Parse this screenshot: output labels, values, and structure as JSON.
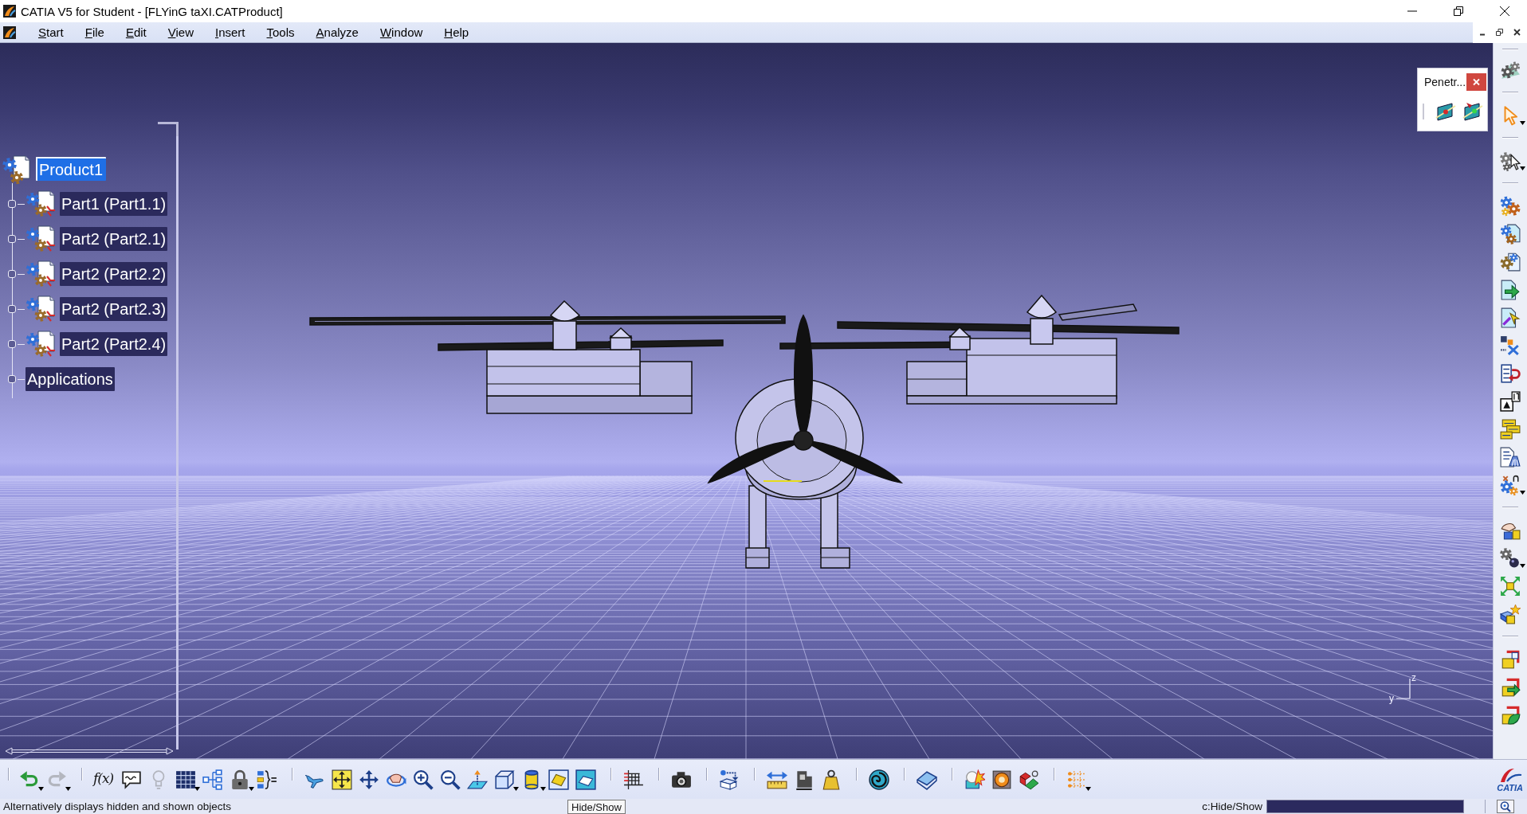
{
  "window": {
    "title": "CATIA V5 for Student - [FLYinG taXI.CATProduct]"
  },
  "menu_bar": {
    "items": [
      "Start",
      "File",
      "Edit",
      "View",
      "Insert",
      "Tools",
      "Analyze",
      "Window",
      "Help"
    ]
  },
  "tree": {
    "items": [
      {
        "kind": "product",
        "label": "Product1",
        "selected": true,
        "children": [
          {
            "kind": "part",
            "label": "Part1 (Part1.1)",
            "selected": false
          },
          {
            "kind": "part",
            "label": "Part2 (Part2.1)",
            "selected": false
          },
          {
            "kind": "part",
            "label": "Part2 (Part2.2)",
            "selected": false
          },
          {
            "kind": "part",
            "label": "Part2 (Part2.3)",
            "selected": false
          },
          {
            "kind": "part",
            "label": "Part2 (Part2.4)",
            "selected": false
          },
          {
            "kind": "branch",
            "label": "Applications",
            "selected": false
          }
        ]
      }
    ]
  },
  "penetration_panel": {
    "title": "Penetr..."
  },
  "compass": {
    "z_label": "z",
    "y_label": "y"
  },
  "right_toolbar": {
    "groups": [
      [
        {
          "kind": "gears",
          "dropdown": false
        }
      ],
      [
        {
          "kind": "pointer",
          "dropdown": true
        }
      ],
      [
        {
          "kind": "gear-pointer",
          "dropdown": true
        }
      ],
      [
        {
          "kind": "gear-cluster",
          "dropdown": false
        },
        {
          "kind": "gear-document",
          "dropdown": false
        },
        {
          "kind": "gear-sheet",
          "dropdown": false
        },
        {
          "kind": "document-arrow",
          "dropdown": false
        },
        {
          "kind": "document-pointer",
          "dropdown": false
        },
        {
          "kind": "blocks-cross",
          "dropdown": false
        },
        {
          "kind": "list-arrow",
          "dropdown": false
        },
        {
          "kind": "triangle-box",
          "dropdown": false
        },
        {
          "kind": "stacked-boxes",
          "dropdown": false
        },
        {
          "kind": "document-fan",
          "dropdown": false
        },
        {
          "kind": "gear-cross",
          "dropdown": true
        }
      ],
      [
        {
          "kind": "hand-blocks",
          "dropdown": false
        },
        {
          "kind": "gear-ball",
          "dropdown": true
        },
        {
          "kind": "explode-arrows",
          "dropdown": false
        },
        {
          "kind": "star-blocks",
          "dropdown": false
        }
      ],
      [
        {
          "kind": "block-corner",
          "dropdown": false
        },
        {
          "kind": "block-arrow",
          "dropdown": false
        },
        {
          "kind": "block-leaf",
          "dropdown": false
        }
      ]
    ]
  },
  "bottom_toolbar": {
    "groups": [
      [
        {
          "kind": "undo",
          "dropdown": true,
          "disabled": false
        },
        {
          "kind": "redo",
          "dropdown": true,
          "disabled": true
        }
      ],
      [
        {
          "kind": "formula",
          "glyph": "f(x)",
          "dropdown": false,
          "disabled": false
        },
        {
          "kind": "comment",
          "dropdown": false,
          "disabled": false
        },
        {
          "kind": "bulb",
          "dropdown": false,
          "disabled": true
        },
        {
          "kind": "table",
          "dropdown": true,
          "disabled": false
        },
        {
          "kind": "tree-graph",
          "dropdown": false,
          "disabled": false
        },
        {
          "kind": "lock",
          "dropdown": true,
          "disabled": false
        },
        {
          "kind": "braces",
          "dropdown": false,
          "disabled": false
        }
      ],
      [
        {
          "kind": "airplane",
          "dropdown": false,
          "disabled": false
        },
        {
          "kind": "fit-all",
          "dropdown": false,
          "disabled": false
        },
        {
          "kind": "pan",
          "dropdown": false,
          "disabled": false
        },
        {
          "kind": "hand-orbit",
          "dropdown": false,
          "disabled": false
        },
        {
          "kind": "zoom-in",
          "dropdown": false,
          "disabled": false
        },
        {
          "kind": "zoom-out",
          "dropdown": false,
          "disabled": false
        },
        {
          "kind": "plane-arrow",
          "dropdown": false,
          "disabled": false
        },
        {
          "kind": "cube",
          "dropdown": true,
          "disabled": false
        },
        {
          "kind": "cylinder",
          "dropdown": true,
          "disabled": false
        },
        {
          "kind": "tile-square",
          "dropdown": false,
          "disabled": false
        },
        {
          "kind": "tile-outline",
          "dropdown": false,
          "disabled": false
        }
      ],
      [
        {
          "kind": "ruler-grid",
          "dropdown": false,
          "disabled": false
        }
      ],
      [
        {
          "kind": "camera",
          "dropdown": false,
          "disabled": false
        }
      ],
      [
        {
          "kind": "box-arrow",
          "dropdown": false,
          "disabled": false
        }
      ],
      [
        {
          "kind": "ruler-arrows",
          "dropdown": false,
          "disabled": false
        },
        {
          "kind": "block-stand",
          "dropdown": false,
          "disabled": false
        },
        {
          "kind": "weight",
          "dropdown": false,
          "disabled": false
        }
      ],
      [
        {
          "kind": "swirl",
          "dropdown": false,
          "disabled": false
        }
      ],
      [
        {
          "kind": "book",
          "dropdown": false,
          "disabled": false
        }
      ],
      [
        {
          "kind": "star-burst",
          "dropdown": false,
          "disabled": false
        },
        {
          "kind": "ring-square",
          "dropdown": false,
          "disabled": false
        },
        {
          "kind": "blocks-ring",
          "dropdown": false,
          "disabled": false
        }
      ],
      [
        {
          "kind": "dotted-grid",
          "dropdown": true,
          "disabled": false
        }
      ]
    ],
    "logo": "CATIA"
  },
  "status_bar": {
    "message": "Alternatively displays hidden and shown objects",
    "tooltip": "Hide/Show",
    "command_label": "c:Hide/Show"
  }
}
